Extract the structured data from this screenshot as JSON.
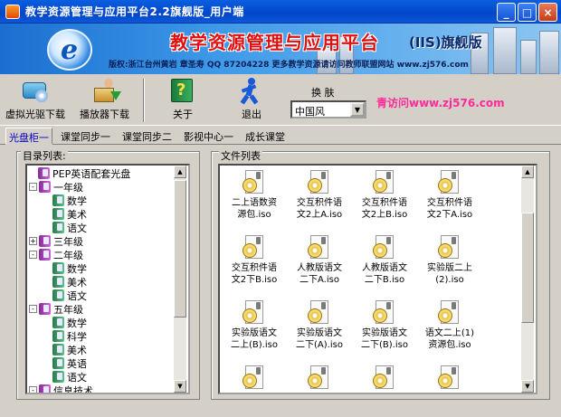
{
  "window": {
    "title": "教学资源管理与应用平台2.2旗舰版_用户端",
    "minimize": "_",
    "maximize": "□",
    "close": "×"
  },
  "banner": {
    "logo_letter": "e",
    "title": "教学资源管理与应用平台",
    "edition": "(IIS)旗舰版",
    "info": "版权:浙江台州黄岩  章圣寿  QQ 87204228    更多教学资源请访问教师联盟网站 www.zj576.com"
  },
  "toolbar": {
    "virtual_cd": "虚拟光驱下载",
    "player": "播放器下载",
    "about": "关于",
    "exit": "退出",
    "skin_label": "换  肤",
    "skin_value": "中国风",
    "promo": "青访问www.zj576.com"
  },
  "tabs": [
    "光盘柜一",
    "课堂同步一",
    "课堂同步二",
    "影视中心一",
    "成长课堂"
  ],
  "tree": {
    "label": "目录列表:",
    "nodes": [
      {
        "text": "PEP英语配套光盘",
        "level": 1,
        "exp": "",
        "icon": "p"
      },
      {
        "text": "一年级",
        "level": 0,
        "exp": "-",
        "icon": "p"
      },
      {
        "text": "数学",
        "level": 2,
        "exp": "",
        "icon": "g"
      },
      {
        "text": "美术",
        "level": 2,
        "exp": "",
        "icon": "g"
      },
      {
        "text": "语文",
        "level": 2,
        "exp": "",
        "icon": "g"
      },
      {
        "text": "三年级",
        "level": 0,
        "exp": "+",
        "icon": "p"
      },
      {
        "text": "二年级",
        "level": 0,
        "exp": "-",
        "icon": "p"
      },
      {
        "text": "数学",
        "level": 2,
        "exp": "",
        "icon": "g"
      },
      {
        "text": "美术",
        "level": 2,
        "exp": "",
        "icon": "g"
      },
      {
        "text": "语文",
        "level": 2,
        "exp": "",
        "icon": "g"
      },
      {
        "text": "五年级",
        "level": 0,
        "exp": "-",
        "icon": "p"
      },
      {
        "text": "数学",
        "level": 2,
        "exp": "",
        "icon": "g"
      },
      {
        "text": "科学",
        "level": 2,
        "exp": "",
        "icon": "g"
      },
      {
        "text": "美术",
        "level": 2,
        "exp": "",
        "icon": "g"
      },
      {
        "text": "英语",
        "level": 2,
        "exp": "",
        "icon": "g"
      },
      {
        "text": "语文",
        "level": 2,
        "exp": "",
        "icon": "g"
      },
      {
        "text": "信息技术",
        "level": 0,
        "exp": "-",
        "icon": "p"
      }
    ]
  },
  "files": {
    "label": "文件列表",
    "items": [
      [
        "二上语数资",
        "源包.iso"
      ],
      [
        "交互积件语",
        "文2上A.iso"
      ],
      [
        "交互积件语",
        "文2上B.iso"
      ],
      [
        "交互积件语",
        "文2下A.iso"
      ],
      [
        "交互积件语",
        "文2下B.iso"
      ],
      [
        "人教版语文",
        "二下A.iso"
      ],
      [
        "人教版语文",
        "二下B.iso"
      ],
      [
        "实验版二上",
        "(2).iso"
      ],
      [
        "实验版语文",
        "二上(B).iso"
      ],
      [
        "实验版语文",
        "二下(A).iso"
      ],
      [
        "实验版语文",
        "二下(B).iso"
      ],
      [
        "语文二上(1)",
        "资源包.iso"
      ],
      [
        "",
        ""
      ],
      [
        "",
        ""
      ],
      [
        "",
        ""
      ],
      [
        "",
        ""
      ]
    ]
  }
}
